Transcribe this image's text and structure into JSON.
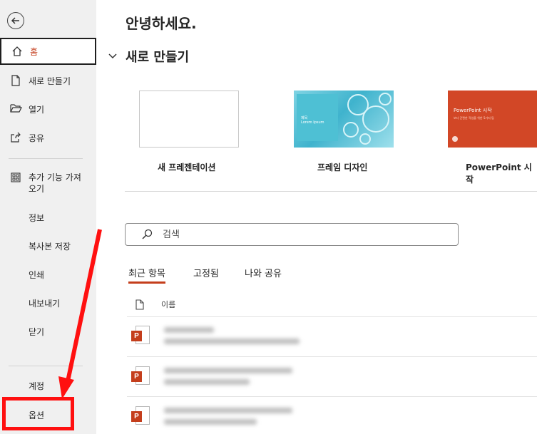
{
  "sidebar": {
    "items": [
      {
        "label": "홈",
        "icon": "home-icon"
      },
      {
        "label": "새로 만들기",
        "icon": "new-document-icon"
      },
      {
        "label": "열기",
        "icon": "folder-open-icon"
      },
      {
        "label": "공유",
        "icon": "share-icon"
      },
      {
        "label": "추가 기능 가져오기",
        "label_line1": "추가 기능 가져",
        "label_line2": "오기",
        "icon": "add-ins-grid-icon"
      },
      {
        "label": "정보"
      },
      {
        "label": "복사본 저장"
      },
      {
        "label": "인쇄"
      },
      {
        "label": "내보내기"
      },
      {
        "label": "닫기"
      },
      {
        "label": "계정"
      },
      {
        "label": "옵션"
      }
    ]
  },
  "main": {
    "greeting": "안녕하세요.",
    "new_section_title": "새로 만들기",
    "templates": [
      {
        "label": "새 프레젠테이션"
      },
      {
        "label": "프레임 디자인",
        "thumb_title": "제목",
        "thumb_sub": "Lorem Ipsum"
      },
      {
        "label": "PowerPoint 시작",
        "thumb_title": "PowerPoint 시작",
        "thumb_sub": "보다 간편한 작업을 위한 5가지 팁"
      }
    ],
    "search": {
      "placeholder": "검색"
    },
    "tabs": [
      {
        "label": "최근 항목",
        "active": true
      },
      {
        "label": "고정됨",
        "active": false
      },
      {
        "label": "나와 공유",
        "active": false
      }
    ],
    "list_header": {
      "name_col": "이름"
    },
    "file_badge": "P"
  },
  "colors": {
    "accent": "#c43e1c",
    "annotation": "#ff1010",
    "sidebar_bg": "#f0f0f0"
  }
}
